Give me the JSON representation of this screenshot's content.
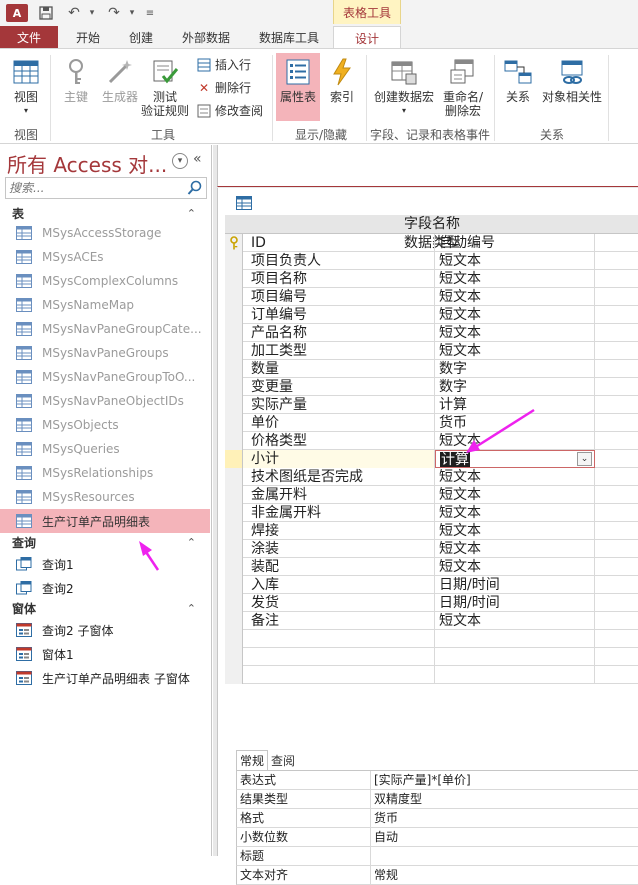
{
  "titlebar": {
    "app_logo": "A",
    "context_tab_title": "表格工具"
  },
  "tabs": [
    {
      "label": "文件"
    },
    {
      "label": "开始"
    },
    {
      "label": "创建"
    },
    {
      "label": "外部数据"
    },
    {
      "label": "数据库工具"
    },
    {
      "label": "设计"
    }
  ],
  "ribbon": {
    "view": "视图",
    "primary_key": "主键",
    "builder": "生成器",
    "test_rules_1": "测试",
    "test_rules_2": "验证规则",
    "insert_rows": "插入行",
    "delete_rows": "删除行",
    "modify_lookups": "修改查阅",
    "property_sheet": "属性表",
    "indexes": "索引",
    "create_macros_1": "创建数据宏",
    "rename_delete_macro_1": "重命名/",
    "rename_delete_macro_2": "删除宏",
    "relationships": "关系",
    "object_dependencies": "对象相关性",
    "groups": {
      "views": "视图",
      "tools": "工具",
      "show_hide": "显示/隐藏",
      "field_record_events": "字段、记录和表格事件",
      "relationships": "关系"
    }
  },
  "nav": {
    "title": "所有 Access 对...",
    "search_placeholder": "搜索...",
    "sections": {
      "tables": "表",
      "queries": "查询",
      "forms": "窗体"
    },
    "tables": [
      "MSysAccessStorage",
      "MSysACEs",
      "MSysComplexColumns",
      "MSysNameMap",
      "MSysNavPaneGroupCate...",
      "MSysNavPaneGroups",
      "MSysNavPaneGroupToO...",
      "MSysNavPaneObjectIDs",
      "MSysObjects",
      "MSysQueries",
      "MSysRelationships",
      "MSysResources",
      "生产订单产品明细表"
    ],
    "queries": [
      "查询1",
      "查询2"
    ],
    "forms": [
      "查询2 子窗体",
      "窗体1",
      "生产订单产品明细表 子窗体"
    ]
  },
  "grid": {
    "col_field": "字段名称",
    "col_type": "数据类型",
    "rows": [
      {
        "name": "ID",
        "type": "自动编号"
      },
      {
        "name": "项目负责人",
        "type": "短文本"
      },
      {
        "name": "项目名称",
        "type": "短文本"
      },
      {
        "name": "项目编号",
        "type": "短文本"
      },
      {
        "name": "订单编号",
        "type": "短文本"
      },
      {
        "name": "产品名称",
        "type": "短文本"
      },
      {
        "name": "加工类型",
        "type": "短文本"
      },
      {
        "name": "数量",
        "type": "数字"
      },
      {
        "name": "变更量",
        "type": "数字"
      },
      {
        "name": "实际产量",
        "type": "计算"
      },
      {
        "name": "单价",
        "type": "货币"
      },
      {
        "name": "价格类型",
        "type": "短文本"
      },
      {
        "name": "小计",
        "type": "计算"
      },
      {
        "name": "技术图纸是否完成",
        "type": "短文本"
      },
      {
        "name": "金属开料",
        "type": "短文本"
      },
      {
        "name": "非金属开料",
        "type": "短文本"
      },
      {
        "name": "焊接",
        "type": "短文本"
      },
      {
        "name": "涂装",
        "type": "短文本"
      },
      {
        "name": "装配",
        "type": "短文本"
      },
      {
        "name": "入库",
        "type": "日期/时间"
      },
      {
        "name": "发货",
        "type": "日期/时间"
      },
      {
        "name": "备注",
        "type": "短文本"
      }
    ]
  },
  "properties": {
    "tab_general": "常规",
    "tab_lookup": "查阅",
    "rows": [
      {
        "name": "表达式",
        "value": "[实际产量]*[单价]"
      },
      {
        "name": "结果类型",
        "value": "双精度型"
      },
      {
        "name": "格式",
        "value": "货币"
      },
      {
        "name": "小数位数",
        "value": "自动"
      },
      {
        "name": "标题",
        "value": ""
      },
      {
        "name": "文本对齐",
        "value": "常规"
      }
    ]
  },
  "colors": {
    "brand": "#a4373a",
    "selection": "#f4b4ba",
    "annotation_arrow": "#ee22ee"
  }
}
